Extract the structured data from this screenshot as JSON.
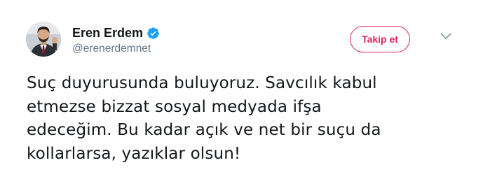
{
  "user": {
    "display_name": "Eren Erdem",
    "handle": "@erenerdemnet",
    "verified_icon": "verified-badge-icon"
  },
  "follow_button": {
    "label": "Takip et"
  },
  "menu": {
    "icon": "chevron-down-icon"
  },
  "tweet": {
    "lines": [
      "Suç duyurusunda buluyoruz. Savcılık kabul",
      "etmezse bizzat sosyal medyada ifşa",
      "edeceğim. Bu kadar açık ve net bir suçu da",
      "kollarlarsa, yazıklar olsun!"
    ]
  },
  "colors": {
    "follow_accent": "#e0245e",
    "verified_blue": "#1da1f2",
    "text_primary": "#14171a",
    "text_secondary": "#657786"
  }
}
